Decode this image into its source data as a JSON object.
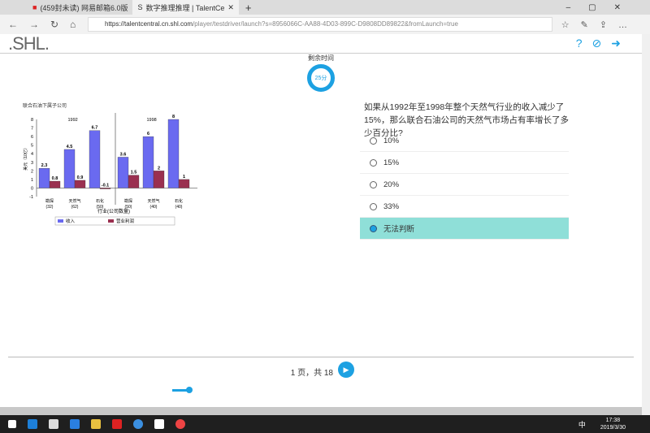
{
  "browser": {
    "tabs": [
      {
        "label": "(459封未读) 网易邮箱6.0版"
      },
      {
        "label": "数字推理推理 | TalentCe"
      }
    ],
    "url_host": "https://talentcentral.cn.shl.com",
    "url_path": "/player/testdriver/launch?s=8956066C-AA88-4D03-899C-D9808DD89822&fromLaunch=true"
  },
  "app": {
    "logo": ".SHL.",
    "timer_label": "剩余时间",
    "timer_value": "25分"
  },
  "question": {
    "text": "如果从1992年至1998年整个天然气行业的收入减少了15%，那么联合石油公司的天然气市场占有率增长了多少百分比?",
    "options": [
      {
        "label": "10%",
        "selected": false
      },
      {
        "label": "15%",
        "selected": false
      },
      {
        "label": "20%",
        "selected": false
      },
      {
        "label": "33%",
        "selected": false
      },
      {
        "label": "无法判断",
        "selected": true
      }
    ]
  },
  "pager": {
    "text": "1 页，共 18"
  },
  "taskbar": {
    "ime": "中",
    "time": "17:38",
    "date": "2019/3/30"
  },
  "chart_data": {
    "type": "bar",
    "title": "联合石油下属子公司",
    "ylabel": "美元（10亿）",
    "xlabel": "行业(公司数量)",
    "ylim": [
      -1,
      8
    ],
    "yticks": [
      -1,
      0,
      1,
      2,
      3,
      4,
      5,
      6,
      7,
      8
    ],
    "groups": [
      {
        "label": "1992",
        "categories": [
          "勘探",
          "天然气",
          "石化"
        ],
        "counts": [
          "(32)",
          "(62)",
          "(50)"
        ],
        "revenue": [
          2.3,
          4.5,
          6.7
        ],
        "profit": [
          0.8,
          0.9,
          -0.1
        ]
      },
      {
        "label": "1998",
        "categories": [
          "勘探",
          "天然气",
          "石化"
        ],
        "counts": [
          "(50)",
          "(40)",
          "(40)"
        ],
        "revenue": [
          3.6,
          6.0,
          8.0
        ],
        "profit": [
          1.5,
          2.0,
          1.0
        ]
      }
    ],
    "legend": [
      "收入",
      "营业利润"
    ],
    "colors": {
      "revenue": "#6a6af0",
      "profit": "#9a3050"
    }
  }
}
